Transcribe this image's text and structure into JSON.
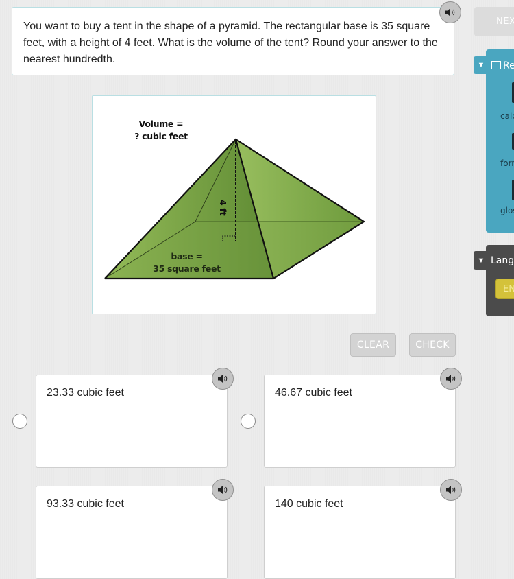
{
  "question": {
    "text": "You want to buy a tent in the shape of a pyramid. The rectangular base is 35 square feet, with a height of 4 feet. What is the volume of the tent? Round your answer to the nearest hundredth.",
    "speaker_icon": "speaker-icon"
  },
  "figure": {
    "volume_label_line1": "Volume =",
    "volume_label_line2": "? cubic feet",
    "height_label": "4 ft",
    "base_label_line1": "base =",
    "base_label_line2": "35 square feet",
    "colors": {
      "face_light": "#94b85a",
      "face_mid": "#7ea446",
      "face_dark": "#5f8a34",
      "edge": "#111111"
    }
  },
  "actions": {
    "clear_label": "CLEAR",
    "check_label": "CHECK"
  },
  "navigation": {
    "next_label": "NEXT"
  },
  "resources": {
    "title": "Resources",
    "items": [
      {
        "label": "calculator",
        "icon": "calculator-icon"
      },
      {
        "label": "formulas",
        "icon": "formula-icon"
      },
      {
        "label": "glossary",
        "icon": "glossary-icon"
      }
    ],
    "color": "#4aa6c0"
  },
  "language": {
    "title": "Language",
    "button_label": "EN",
    "color": "#4b4b4b",
    "button_color": "#d4c23a"
  },
  "options": [
    {
      "label": "23.33 cubic feet",
      "selected": false
    },
    {
      "label": "46.67 cubic feet",
      "selected": false
    },
    {
      "label": "93.33 cubic feet",
      "selected": false
    },
    {
      "label": "140 cubic feet",
      "selected": false
    }
  ]
}
